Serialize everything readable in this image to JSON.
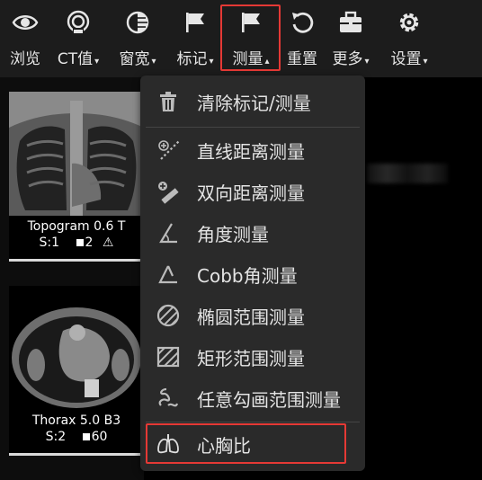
{
  "toolbar": {
    "browse": "浏览",
    "ct_value": "CT值",
    "window_width": "窗宽",
    "annotate": "标记",
    "measure": "测量",
    "reset": "重置",
    "more": "更多",
    "settings": "设置",
    "caret_down": "▾",
    "caret_up": "▴"
  },
  "series": [
    {
      "name": "Topogram 0.6 T",
      "series_no": "S:1",
      "image_count": "2"
    },
    {
      "name": "Thorax 5.0 B3",
      "series_no": "S:2",
      "image_count": "60"
    }
  ],
  "measure_menu": {
    "clear": "清除标记/测量",
    "line": "直线距离测量",
    "bidirectional": "双向距离测量",
    "angle": "角度测量",
    "cobb": "Cobb角测量",
    "ellipse": "椭圆范围测量",
    "rectangle": "矩形范围测量",
    "freehand": "任意勾画范围测量",
    "cardiothoracic": "心胸比"
  },
  "colors": {
    "highlight": "#e53935",
    "menu_bg": "#2a2a2a",
    "toolbar_bg": "#1c1c1c"
  },
  "icons": [
    "eye-icon",
    "ct-value-icon",
    "window-width-icon",
    "flag-icon",
    "measure-flag-icon",
    "reset-icon",
    "toolbox-icon",
    "gear-icon",
    "trash-icon",
    "line-measure-icon",
    "bidirectional-icon",
    "angle-icon",
    "cobb-angle-icon",
    "ellipse-icon",
    "rectangle-icon",
    "freehand-icon",
    "lungs-icon"
  ]
}
